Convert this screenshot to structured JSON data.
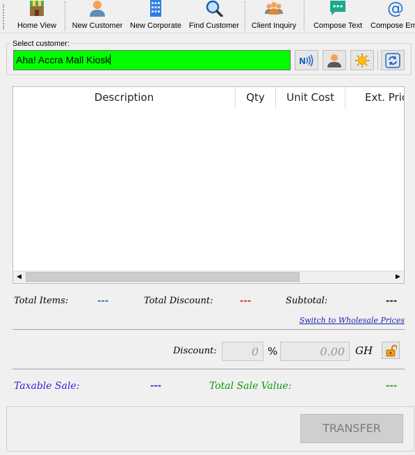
{
  "toolbar": {
    "items": [
      {
        "label": "Home View",
        "icon": "shop-icon"
      },
      {
        "label": "New Customer",
        "icon": "person-icon"
      },
      {
        "label": "New Corporate",
        "icon": "building-icon"
      },
      {
        "label": "Find Customer",
        "icon": "magnifier-icon"
      },
      {
        "label": "Client Inquiry",
        "icon": "group-icon"
      },
      {
        "label": "Compose Text",
        "icon": "chat-bubble-icon"
      },
      {
        "label": "Compose Ema",
        "icon": "at-sign-icon"
      }
    ]
  },
  "customer": {
    "group_label": "Select customer:",
    "value": "Aha! Accra Mall Kiosk",
    "input_bg": "#00ff00"
  },
  "grid": {
    "columns": [
      "Description",
      "Qty",
      "Unit Cost",
      "Ext. Price"
    ],
    "rows": []
  },
  "totals": {
    "total_items_label": "Total Items:",
    "total_items_value": "---",
    "total_discount_label": "Total Discount:",
    "total_discount_value": "---",
    "subtotal_label": "Subtotal:",
    "subtotal_value": "---"
  },
  "wholesale_link": "Switch to Wholesale Prices",
  "discount": {
    "label": "Discount:",
    "percent_value": "0",
    "percent_symbol": "%",
    "amount_value": "0.00",
    "currency": "GH"
  },
  "sale": {
    "taxable_label": "Taxable Sale:",
    "taxable_value": "---",
    "total_label": "Total Sale Value:",
    "total_value": "---"
  },
  "transfer_button": "TRANSFER",
  "colors": {
    "blue_value": "#1f5fd6",
    "red_value": "#dd1111",
    "purple": "#3c16d6",
    "green": "#0a9a0a"
  }
}
